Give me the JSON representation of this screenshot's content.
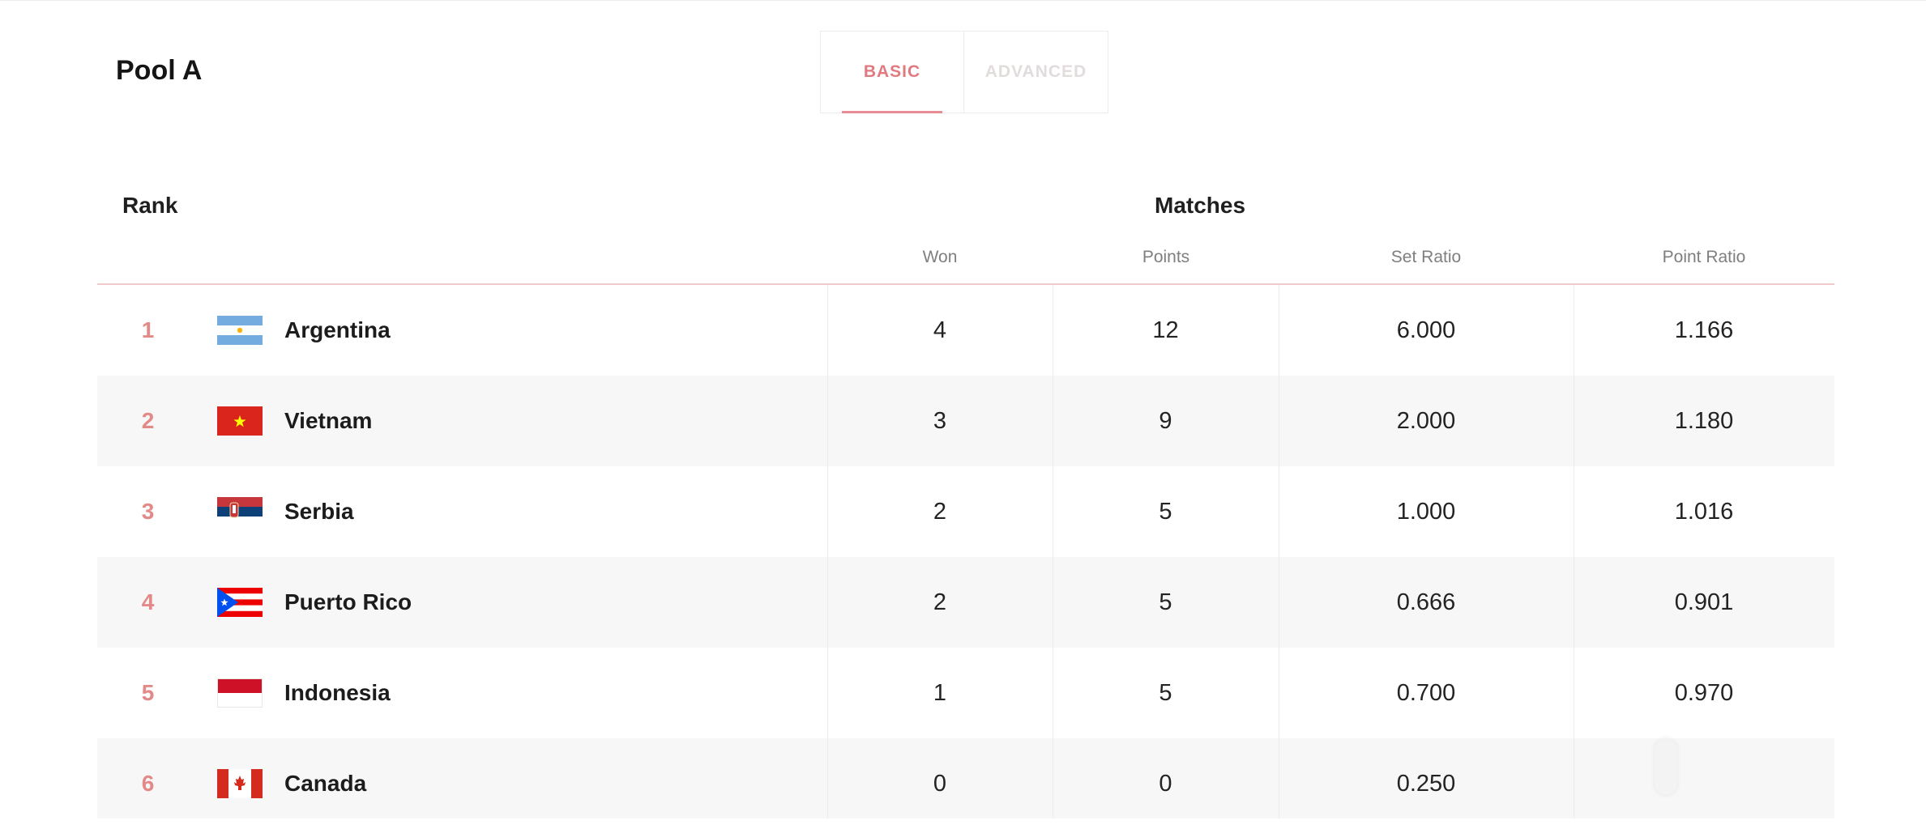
{
  "pool": {
    "title": "Pool A"
  },
  "tabs": [
    {
      "label": "BASIC",
      "active": true
    },
    {
      "label": "ADVANCED",
      "active": false
    }
  ],
  "table": {
    "rank_header": "Rank",
    "matches_header": "Matches",
    "columns": [
      "Won",
      "Points",
      "Set Ratio",
      "Point Ratio"
    ],
    "rows": [
      {
        "rank": "1",
        "team": "Argentina",
        "flag": "argentina-flag-icon",
        "won": "4",
        "points": "12",
        "set_ratio": "6.000",
        "point_ratio": "1.166"
      },
      {
        "rank": "2",
        "team": "Vietnam",
        "flag": "vietnam-flag-icon",
        "won": "3",
        "points": "9",
        "set_ratio": "2.000",
        "point_ratio": "1.180"
      },
      {
        "rank": "3",
        "team": "Serbia",
        "flag": "serbia-flag-icon",
        "won": "2",
        "points": "5",
        "set_ratio": "1.000",
        "point_ratio": "1.016"
      },
      {
        "rank": "4",
        "team": "Puerto Rico",
        "flag": "puerto-rico-flag-icon",
        "won": "2",
        "points": "5",
        "set_ratio": "0.666",
        "point_ratio": "0.901"
      },
      {
        "rank": "5",
        "team": "Indonesia",
        "flag": "indonesia-flag-icon",
        "won": "1",
        "points": "5",
        "set_ratio": "0.700",
        "point_ratio": "0.970"
      },
      {
        "rank": "6",
        "team": "Canada",
        "flag": "canada-flag-icon",
        "won": "0",
        "points": "0",
        "set_ratio": "0.250",
        "point_ratio": ""
      }
    ]
  },
  "colors": {
    "accent": "#e07a80",
    "rank": "#e38a88",
    "row_alt": "#f7f7f7"
  }
}
